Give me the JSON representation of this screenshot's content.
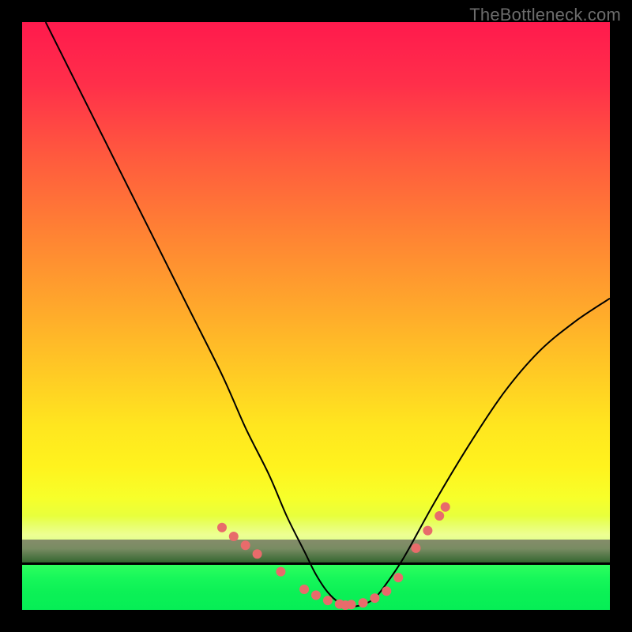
{
  "watermark": "TheBottleneck.com",
  "colors": {
    "frame": "#000000",
    "curve": "#000000",
    "marker": "#e86b6b",
    "green_band": "#17f75a"
  },
  "chart_data": {
    "type": "line",
    "title": "",
    "xlabel": "",
    "ylabel": "",
    "xlim": [
      0,
      100
    ],
    "ylim": [
      0,
      100
    ],
    "grid": false,
    "legend": false,
    "green_band_y_percent": [
      0,
      8
    ],
    "note": "Y values are vertical percent of plot height (0 = bottom, 100 = top). Curve reaches ~0 near x≈55 and rises toward both edges.",
    "series": [
      {
        "name": "curve",
        "x": [
          4,
          10,
          16,
          22,
          28,
          34,
          38,
          42,
          45,
          48,
          50,
          52,
          54,
          56,
          58,
          60,
          62,
          65,
          70,
          76,
          82,
          88,
          94,
          100
        ],
        "y": [
          100,
          88,
          76,
          64,
          52,
          40,
          31,
          23,
          16,
          10,
          6,
          3,
          1.2,
          0.6,
          0.9,
          2,
          4.5,
          9,
          18,
          28,
          37,
          44,
          49,
          53
        ]
      }
    ],
    "markers": {
      "name": "dots",
      "x": [
        34,
        36,
        38,
        40,
        44,
        48,
        50,
        52,
        54,
        55,
        56,
        58,
        60,
        62,
        64,
        67,
        69,
        71,
        72
      ],
      "y": [
        14,
        12.5,
        11,
        9.5,
        6.5,
        3.5,
        2.5,
        1.6,
        1.0,
        0.8,
        0.9,
        1.2,
        2.0,
        3.2,
        5.5,
        10.5,
        13.5,
        16,
        17.5
      ]
    }
  }
}
